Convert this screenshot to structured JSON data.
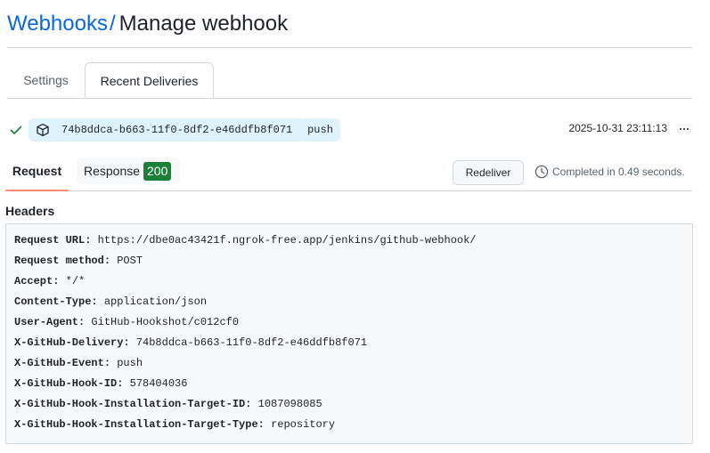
{
  "breadcrumb": {
    "parent_label": "Webhooks",
    "separator": "/",
    "current_label": "Manage webhook"
  },
  "tabs": {
    "settings_label": "Settings",
    "recent_deliveries_label": "Recent Deliveries",
    "active": "Recent Deliveries"
  },
  "delivery": {
    "status_icon": "check-icon",
    "guid": "74b8ddca-b663-11f0-8df2-e46ddfb8f071",
    "event": "push",
    "timestamp": "2025-10-31 23:11:13",
    "more_icon": "kebab-horizontal-icon"
  },
  "detail_tabs": {
    "request_label": "Request",
    "response_label": "Response",
    "response_status": "200",
    "active": "Request"
  },
  "actions": {
    "redeliver_label": "Redeliver",
    "completed_text": "Completed in 0.49 seconds."
  },
  "headers": {
    "title": "Headers",
    "rows": [
      {
        "key": "Request URL:",
        "value": "https://dbe0ac43421f.ngrok-free.app/jenkins/github-webhook/"
      },
      {
        "key": "Request method:",
        "value": "POST"
      },
      {
        "key": "Accept:",
        "value": "*/*"
      },
      {
        "key": "Content-Type:",
        "value": "application/json"
      },
      {
        "key": "User-Agent:",
        "value": "GitHub-Hookshot/c012cf0"
      },
      {
        "key": "X-GitHub-Delivery:",
        "value": "74b8ddca-b663-11f0-8df2-e46ddfb8f071"
      },
      {
        "key": "X-GitHub-Event:",
        "value": "push"
      },
      {
        "key": "X-GitHub-Hook-ID:",
        "value": "578404036"
      },
      {
        "key": "X-GitHub-Hook-Installation-Target-ID:",
        "value": "1087098085"
      },
      {
        "key": "X-GitHub-Hook-Installation-Target-Type:",
        "value": "repository"
      }
    ]
  },
  "colors": {
    "link": "#0969da",
    "success": "#1a7f37",
    "pill_bg": "#ddf4ff",
    "active_tab_underline": "#fd8c73"
  }
}
